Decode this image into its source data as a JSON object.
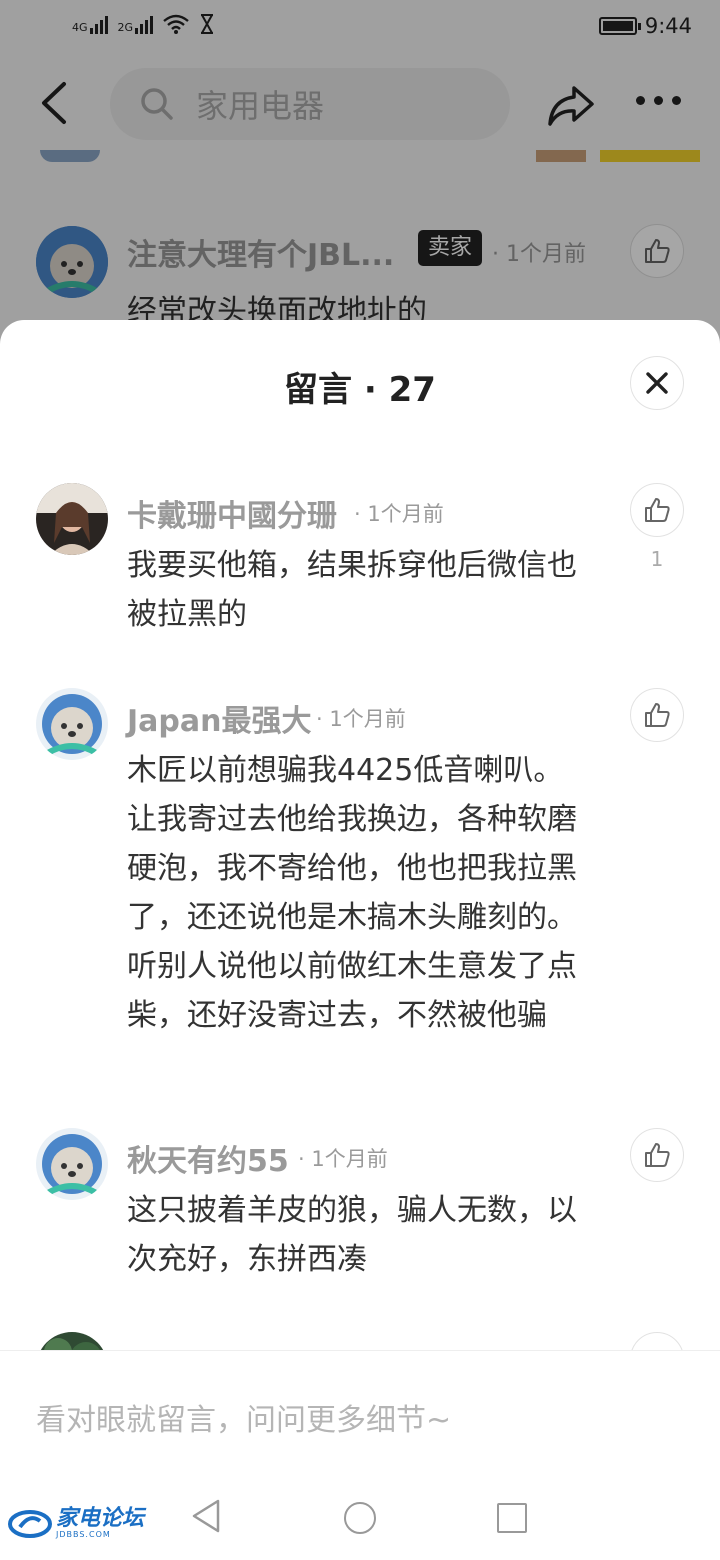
{
  "status_bar": {
    "network_1": "4G",
    "network_2": "2G",
    "time": "9:44"
  },
  "top_bar": {
    "search_placeholder": "家用电器"
  },
  "background_comment": {
    "name": "注意大理有个JBL...",
    "badge": "卖家",
    "time": "· 1个月前",
    "text": "经常改头换面改地址的"
  },
  "sheet": {
    "title": "留言 · 27",
    "comments": [
      {
        "name": "卡戴珊中國分珊",
        "time": "· 1个月前",
        "text": "我要买他箱，结果拆穿他后微信也被拉黑的",
        "likes": "1"
      },
      {
        "name": "Japan最强大",
        "time": "· 1个月前",
        "text": "木匠以前想骗我4425低音喇叭。让我寄过去他给我换边，各种软磨硬泡，我不寄给他，他也把我拉黑了，还还说他是木搞木头雕刻的。听别人说他以前做红木生意发了点柴，还好没寄过去，不然被他骗"
      },
      {
        "name": "秋天有约55",
        "time": "· 1个月前",
        "text": "这只披着羊皮的狼，骗人无数，以次充好，东拼西凑"
      }
    ],
    "input_placeholder": "看对眼就留言，问问更多细节~"
  },
  "watermark": {
    "text": "家电论坛",
    "sub": "JDBBS.COM"
  },
  "colors": {
    "brand_blue": "#1b6fc4",
    "badge_bg": "#222222"
  }
}
